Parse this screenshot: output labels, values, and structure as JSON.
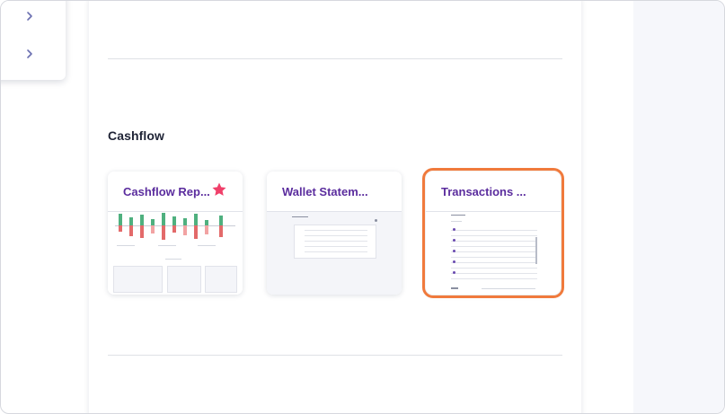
{
  "section": {
    "title": "Cashflow"
  },
  "cards": [
    {
      "title": "Cashflow Rep...",
      "favorite": true,
      "selected": false
    },
    {
      "title": "Wallet Statem...",
      "favorite": false,
      "selected": false
    },
    {
      "title": "Transactions ...",
      "favorite": false,
      "selected": true
    }
  ],
  "icons": {
    "menu_chevron": "chevron-right-icon",
    "favorite": "star-icon"
  },
  "colors": {
    "card_title": "#5b2d9e",
    "selected_outline": "#f07a3c",
    "favorite_star": "#f0406a"
  }
}
